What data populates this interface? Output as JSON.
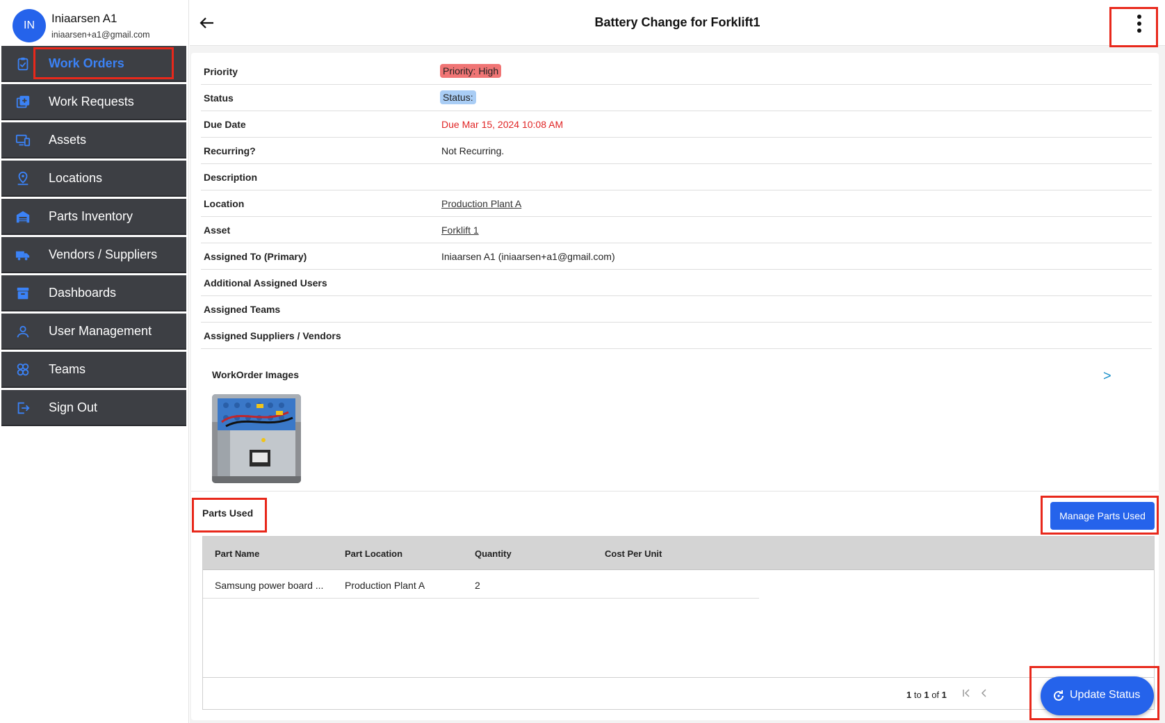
{
  "user": {
    "initials": "IN",
    "name": "Iniaarsen A1",
    "email": "iniaarsen+a1@gmail.com"
  },
  "sidebar": {
    "items": [
      {
        "label": "Work Orders",
        "icon": "clipboard-icon",
        "active": true
      },
      {
        "label": "Work Requests",
        "icon": "add-box-icon",
        "active": false
      },
      {
        "label": "Assets",
        "icon": "devices-icon",
        "active": false
      },
      {
        "label": "Locations",
        "icon": "map-pin-icon",
        "active": false
      },
      {
        "label": "Parts Inventory",
        "icon": "warehouse-icon",
        "active": false
      },
      {
        "label": "Vendors / Suppliers",
        "icon": "truck-icon",
        "active": false
      },
      {
        "label": "Dashboards",
        "icon": "archive-icon",
        "active": false
      },
      {
        "label": "User Management",
        "icon": "person-icon",
        "active": false
      },
      {
        "label": "Teams",
        "icon": "team-icon",
        "active": false
      },
      {
        "label": "Sign Out",
        "icon": "logout-icon",
        "active": false
      }
    ]
  },
  "header": {
    "title": "Battery Change for Forklift1"
  },
  "details": {
    "priority_label": "Priority",
    "priority_value": "Priority: High",
    "status_label": "Status",
    "status_value": "Status:",
    "due_label": "Due Date",
    "due_value": "Due Mar 15, 2024 10:08 AM",
    "recurring_label": "Recurring?",
    "recurring_value": "Not Recurring.",
    "description_label": "Description",
    "description_value": "",
    "location_label": "Location",
    "location_value": "Production Plant A",
    "asset_label": "Asset",
    "asset_value": "Forklift 1",
    "assigned_label": "Assigned To (Primary)",
    "assigned_value": "Iniaarsen A1 (iniaarsen+a1@gmail.com)",
    "additional_users_label": "Additional Assigned Users",
    "teams_label": "Assigned Teams",
    "vendors_label": "Assigned Suppliers / Vendors"
  },
  "images": {
    "title": "WorkOrder Images",
    "next": ">"
  },
  "parts": {
    "title": "Parts Used",
    "manage_label": "Manage Parts Used",
    "columns": [
      "Part Name",
      "Part Location",
      "Quantity",
      "Cost Per Unit"
    ],
    "rows": [
      [
        "Samsung power board ...",
        "Production Plant A",
        "2",
        ""
      ]
    ],
    "pager": {
      "from": "1",
      "to_word": "to",
      "to": "1",
      "of_word": "of",
      "total": "1"
    }
  },
  "fab": {
    "label": "Update Status"
  },
  "colors": {
    "accent": "#2563eb",
    "sidebar_bg": "#3d3f44",
    "priority_high": "#f07575",
    "status_badge": "#a9cdf5",
    "due_text": "#e02424",
    "highlight": "#e8281b"
  }
}
